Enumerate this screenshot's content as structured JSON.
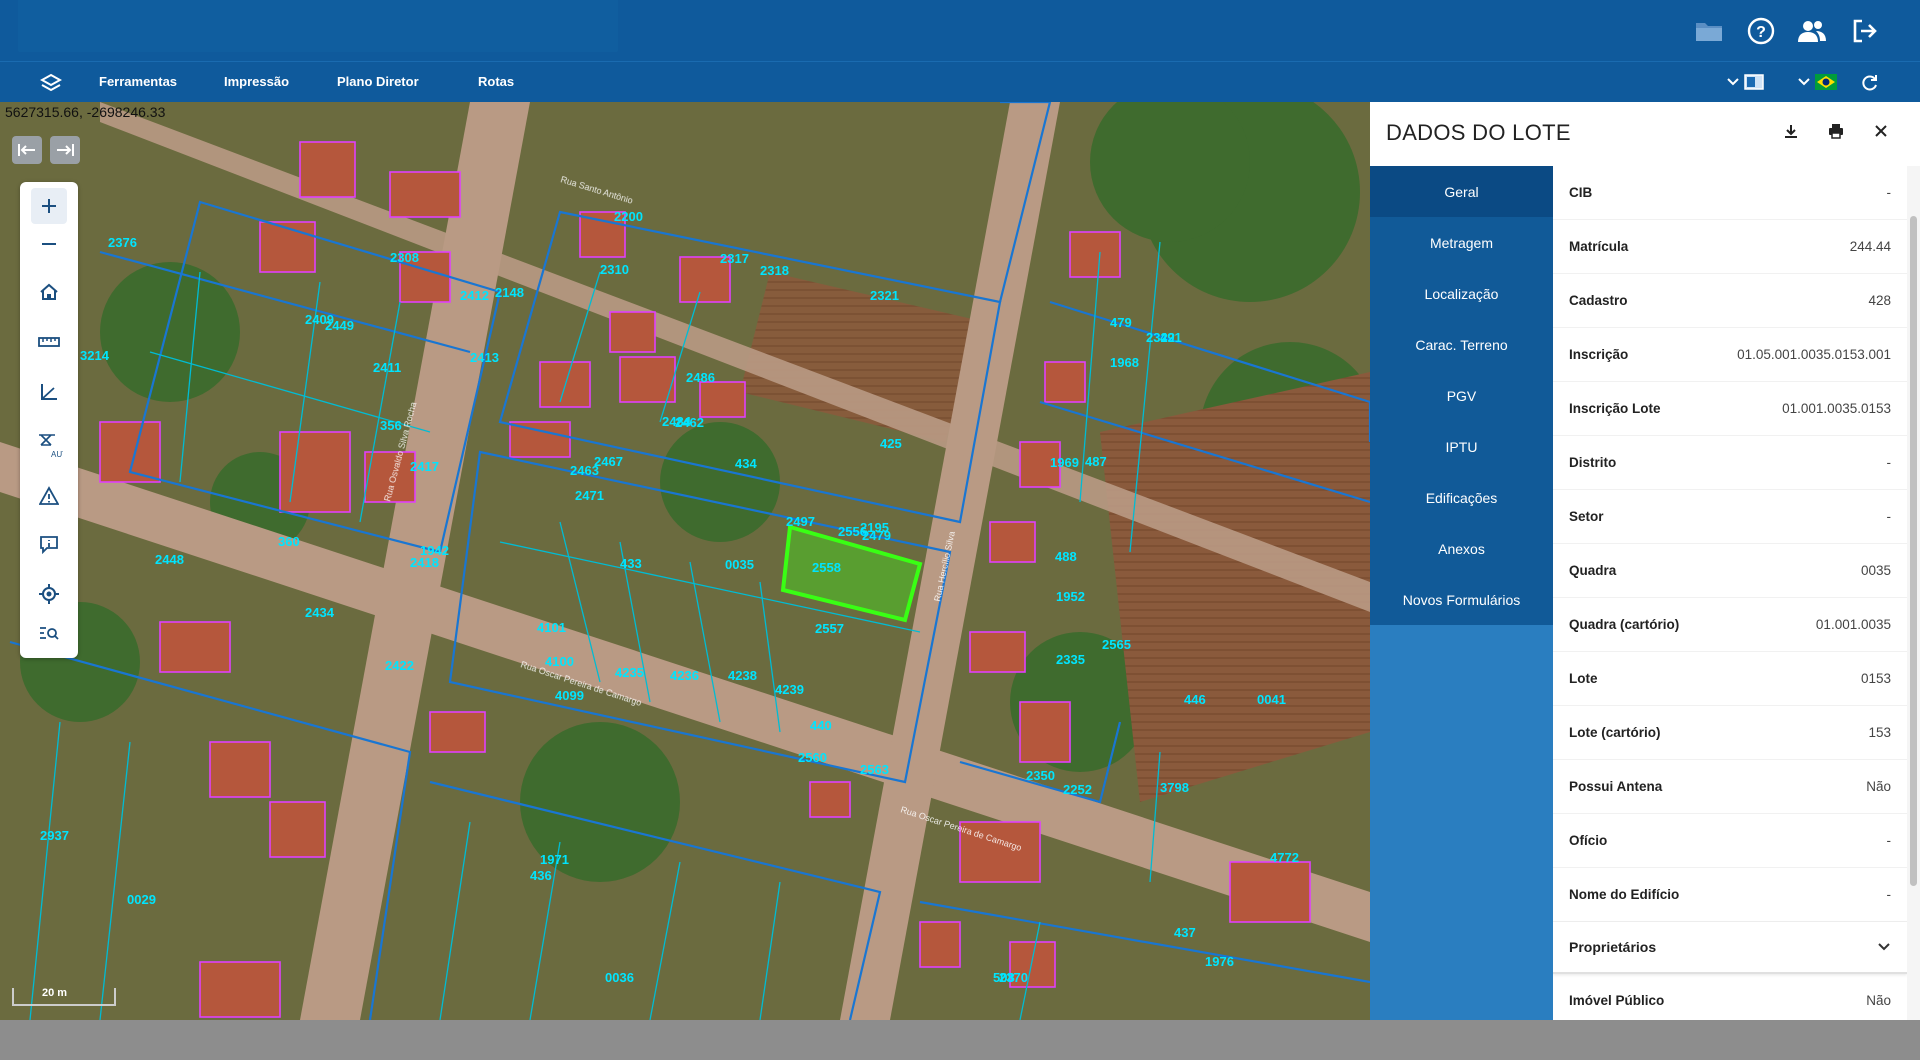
{
  "menu": {
    "items": [
      "Ferramentas",
      "Impressão",
      "Plano Diretor",
      "Rotas"
    ]
  },
  "map": {
    "coordinates": "5627315.66, -2698246.33",
    "scale_label": "20 m",
    "street_labels": [
      "Rua Santo Antônio",
      "Rua Oscar Pereira de Camargo",
      "Rua Osvaldo Silva Rocha",
      "Rua Hercílio Silva"
    ],
    "lot_numbers": [
      "425",
      "434",
      "433",
      "4101",
      "4100",
      "4099",
      "4235",
      "4236",
      "4238",
      "4239",
      "2195",
      "356",
      "360",
      "1942",
      "2148",
      "2308",
      "2409",
      "2411",
      "2412",
      "2413",
      "2417",
      "2418",
      "2422",
      "2434",
      "2448",
      "2449",
      "2462",
      "2463",
      "2467",
      "2471",
      "2479",
      "2484",
      "2486",
      "2497",
      "2556",
      "2557",
      "2558",
      "2560",
      "2563",
      "2565",
      "2252",
      "2335",
      "2350",
      "2370",
      "508",
      "1976",
      "1971",
      "440",
      "436",
      "437",
      "446",
      "491",
      "479",
      "487",
      "488",
      "1952",
      "1968",
      "1969",
      "2200",
      "2310",
      "2317",
      "2318",
      "2321",
      "2322",
      "2376",
      "3214",
      "2937",
      "0041",
      "0029",
      "0036",
      "0035",
      "3798",
      "4772"
    ],
    "colors": {
      "lot_line": "#1976d2",
      "parcel_line": "#00bcd4",
      "building_line": "#e040fb",
      "label": "#00e5ff",
      "selected": "#39ff14"
    }
  },
  "panel": {
    "title": "DADOS DO LOTE",
    "icons": [
      "download-icon",
      "print-icon",
      "close-icon"
    ],
    "tabs": [
      "Geral",
      "Metragem",
      "Localização",
      "Carac. Terreno",
      "PGV",
      "IPTU",
      "Edificações",
      "Anexos",
      "Novos Formulários"
    ],
    "active_tab": "Geral",
    "fields": [
      {
        "label": "CIB",
        "value": "-"
      },
      {
        "label": "Matrícula",
        "value": "244.44"
      },
      {
        "label": "Cadastro",
        "value": "428"
      },
      {
        "label": "Inscrição",
        "value": "01.05.001.0035.0153.001"
      },
      {
        "label": "Inscrição Lote",
        "value": "01.001.0035.0153"
      },
      {
        "label": "Distrito",
        "value": "-"
      },
      {
        "label": "Setor",
        "value": "-"
      },
      {
        "label": "Quadra",
        "value": "0035"
      },
      {
        "label": "Quadra (cartório)",
        "value": "01.001.0035"
      },
      {
        "label": "Lote",
        "value": "0153"
      },
      {
        "label": "Lote (cartório)",
        "value": "153"
      },
      {
        "label": "Possui Antena",
        "value": "Não"
      },
      {
        "label": "Ofício",
        "value": "-"
      },
      {
        "label": "Nome do Edifício",
        "value": "-"
      }
    ],
    "section": "Proprietários",
    "after_section": [
      {
        "label": "Imóvel Público",
        "value": "Não"
      }
    ]
  }
}
